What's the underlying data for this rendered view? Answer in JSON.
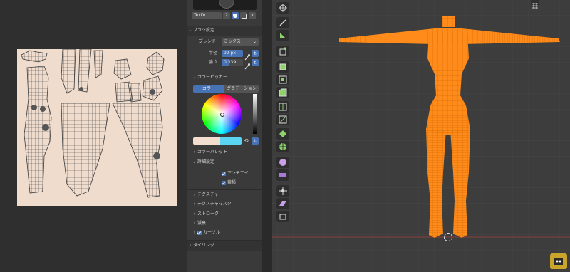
{
  "sidebar": {
    "brush_name": "TexDr…",
    "brush_users": "2",
    "brush_settings": {
      "header": "ブラシ設定",
      "blend_label": "ブレンド",
      "blend_value": "ミックス",
      "radius_label": "半径",
      "radius_value": "92 px",
      "strength_label": "強さ",
      "strength_value": "0.339"
    },
    "color_picker": {
      "header": "カラーピッカー",
      "tab_color": "カラー",
      "tab_gradient": "グラデーション"
    },
    "color_palette": "カラーパレット",
    "advanced": {
      "header": "詳細設定",
      "antialias": "アンチエイ…",
      "accumulate": "蓄積"
    },
    "texture": "テクスチャ",
    "texture_mask": "テクスチャマスク",
    "stroke": "ストローク",
    "falloff": "減衰",
    "cursor": "カーソル",
    "tiling": "タイリング"
  },
  "colors": {
    "accent": "#4772b3",
    "mesh": "#ff8c1a",
    "primary_color": "#f2ddcf",
    "secondary_color": "#5ad4f0",
    "uv_background": "#f0dccd"
  },
  "icons": [
    "shield-icon",
    "copy-icon",
    "close-icon",
    "eyedropper-icon",
    "pressure-icon",
    "swap-icon",
    "chevron-down-icon",
    "chevron-right-icon",
    "grid-icon",
    "cursor-icon",
    "draw-icon",
    "measure-icon",
    "add-cube-icon",
    "cube-icon",
    "extrude-icon",
    "inset-icon",
    "bevel-icon",
    "loop-cut-icon",
    "knife-icon",
    "poly-build-icon",
    "spin-icon",
    "smooth-icon",
    "shear-icon",
    "to-sphere-icon",
    "rip-icon",
    "origin-icon"
  ]
}
